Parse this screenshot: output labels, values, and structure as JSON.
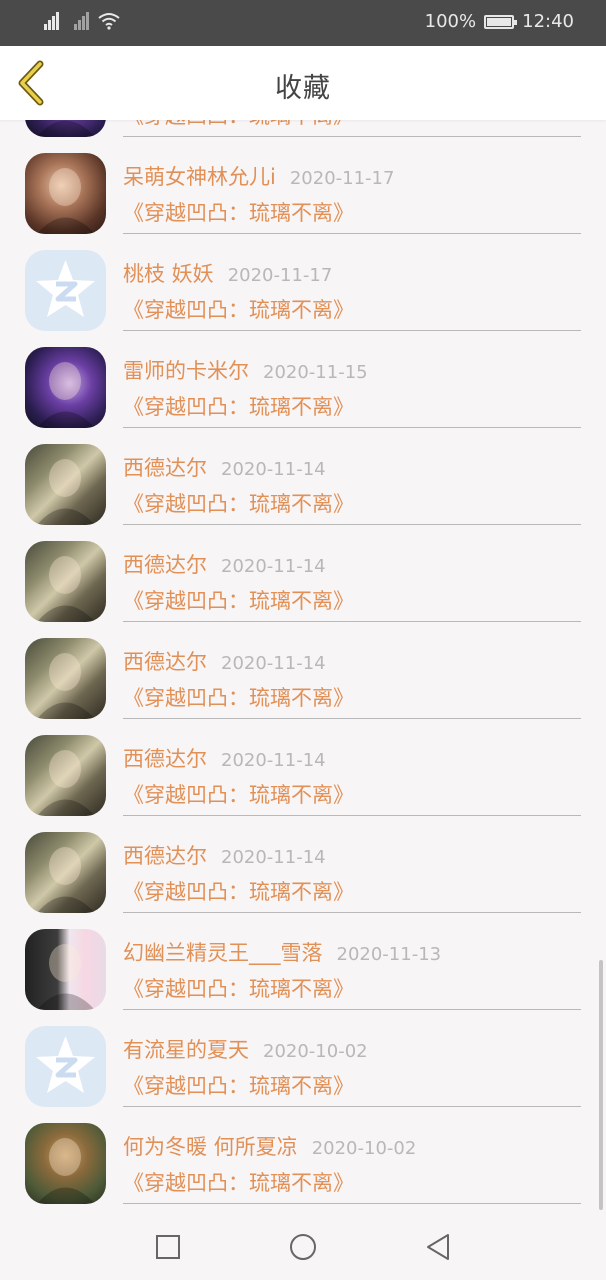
{
  "status_bar": {
    "battery": "100%",
    "time": "12:40"
  },
  "header": {
    "title": "收藏"
  },
  "items": [
    {
      "name": "",
      "date": "",
      "book": "《穿越凹凸：琉璃不离》",
      "avatar": "fantasy-character"
    },
    {
      "name": "呆萌女神林允儿i",
      "date": "2020-11-17",
      "book": "《穿越凹凸：琉璃不离》",
      "avatar": "girl-portrait"
    },
    {
      "name": "桃枝 妖妖",
      "date": "2020-11-17",
      "book": "《穿越凹凸：琉璃不离》",
      "avatar": "qq-star-default"
    },
    {
      "name": "雷师的卡米尔",
      "date": "2020-11-15",
      "book": "《穿越凹凸：琉璃不离》",
      "avatar": "anime-purple"
    },
    {
      "name": "西德达尔",
      "date": "2020-11-14",
      "book": "《穿越凹凸：琉璃不离》",
      "avatar": "anime-armor"
    },
    {
      "name": "西德达尔",
      "date": "2020-11-14",
      "book": "《穿越凹凸：琉璃不离》",
      "avatar": "anime-armor"
    },
    {
      "name": "西德达尔",
      "date": "2020-11-14",
      "book": "《穿越凹凸：琉璃不离》",
      "avatar": "anime-armor"
    },
    {
      "name": "西德达尔",
      "date": "2020-11-14",
      "book": "《穿越凹凸：琉璃不离》",
      "avatar": "anime-armor"
    },
    {
      "name": "西德达尔",
      "date": "2020-11-14",
      "book": "《穿越凹凸：琉璃不离》",
      "avatar": "anime-armor"
    },
    {
      "name": "幻幽兰精灵王___雪落",
      "date": "2020-11-13",
      "book": "《穿越凹凸：琉璃不离》",
      "avatar": "panther-girl"
    },
    {
      "name": "有流星的夏天",
      "date": "2020-10-02",
      "book": "《穿越凹凸：琉璃不离》",
      "avatar": "qq-star-default"
    },
    {
      "name": "何为冬暖 何所夏凉",
      "date": "2020-10-02",
      "book": "《穿越凹凸：琉璃不离》",
      "avatar": "monkey-king"
    }
  ],
  "icons": {
    "back": "chevron-left-icon",
    "nav_recent": "square-icon",
    "nav_home": "circle-icon",
    "nav_back": "triangle-back-icon"
  },
  "colors": {
    "accent": "#e19056",
    "date": "#b8b8b8",
    "status_bar": "#4a4a4a"
  }
}
